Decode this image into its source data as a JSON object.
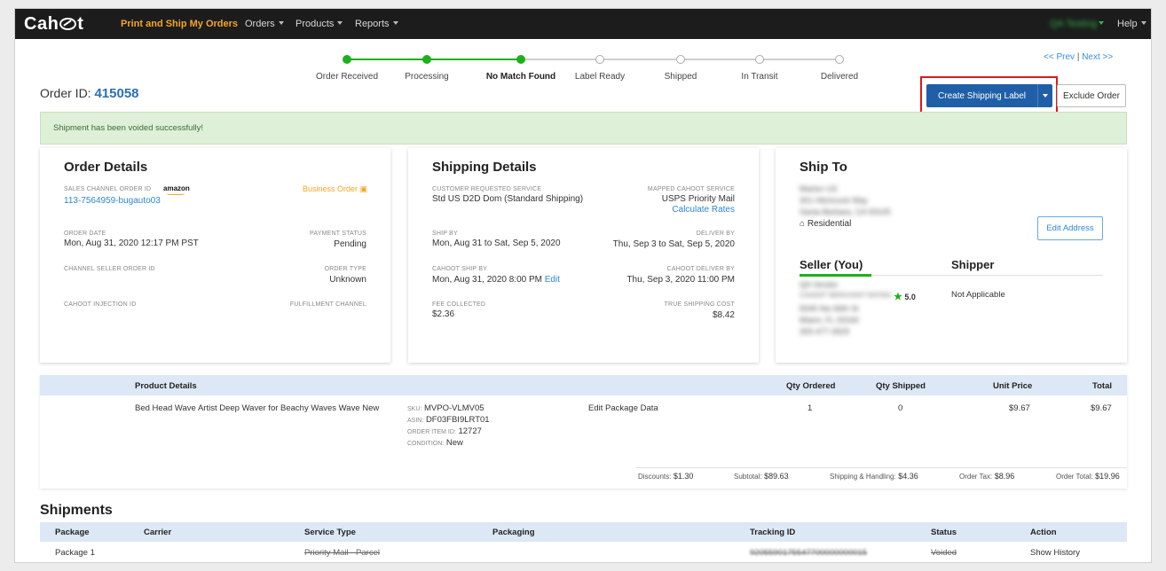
{
  "nav": {
    "logo": "Cah t",
    "active": "Print and Ship My Orders",
    "orders": "Orders",
    "products": "Products",
    "reports": "Reports",
    "user": "QA Testing",
    "help": "Help"
  },
  "progress": {
    "steps": [
      "Order Received",
      "Processing",
      "No Match Found",
      "Label Ready",
      "Shipped",
      "In Transit",
      "Delivered"
    ],
    "completed": 3
  },
  "pager": {
    "prev": "<< Prev",
    "sep": "|",
    "next": "Next >>"
  },
  "order": {
    "id_label": "Order ID:",
    "id": "415058"
  },
  "actions": {
    "create_label": "Create Shipping Label",
    "exclude": "Exclude Order"
  },
  "alert": "Shipment has been voided successfully!",
  "order_details": {
    "title": "Order Details",
    "sales_channel_label": "SALES CHANNEL ORDER ID",
    "amazon": "amazon",
    "business": "Business Order",
    "sales_channel_id": "113-7564959-bugauto03",
    "order_date_label": "ORDER DATE",
    "order_date": "Mon, Aug 31, 2020 12:17 PM PST",
    "payment_status_label": "PAYMENT STATUS",
    "payment_status": "Pending",
    "channel_seller_label": "CHANNEL SELLER ORDER ID",
    "order_type_label": "ORDER TYPE",
    "order_type": "Unknown",
    "injection_label": "CAHOOT INJECTION ID",
    "fulfillment_label": "FULFILLMENT CHANNEL"
  },
  "shipping_details": {
    "title": "Shipping Details",
    "customer_service_label": "CUSTOMER REQUESTED SERVICE",
    "customer_service": "Std US D2D Dom (Standard Shipping)",
    "mapped_label": "MAPPED CAHOOT SERVICE",
    "mapped": "USPS Priority Mail",
    "calc_rates": "Calculate Rates",
    "ship_by_label": "SHIP BY",
    "ship_by": "Mon, Aug 31 to Sat, Sep 5, 2020",
    "deliver_by_label": "DELIVER BY",
    "deliver_by": "Thu, Sep 3 to Sat, Sep 5, 2020",
    "cahoot_ship_label": "CAHOOT SHIP BY",
    "cahoot_ship": "Mon, Aug 31, 2020 8:00 PM",
    "edit": "Edit",
    "cahoot_deliver_label": "CAHOOT DELIVER BY",
    "cahoot_deliver": "Thu, Sep 3, 2020 11:00 PM",
    "fee_label": "FEE COLLECTED",
    "fee": "$2.36",
    "true_cost_label": "TRUE SHIPPING COST",
    "true_cost": "$8.42"
  },
  "ship_to": {
    "title": "Ship To",
    "name": "Marlon US",
    "street": "301 Hitchcock Way",
    "city": "Santa Barbara, CA 93105",
    "residential": "Residential",
    "edit_address": "Edit Address",
    "seller_title": "Seller (You)",
    "shipper_title": "Shipper",
    "seller_name": "QA Vendor",
    "rating_label": "CAHOOT MERCHANT RATING",
    "rating": "5.0",
    "seller_street": "8345 Nw 66th St",
    "seller_city": "Miami, FL 33166",
    "seller_phone": "305-477-3929",
    "shipper_value": "Not Applicable"
  },
  "products": {
    "headers": {
      "details": "Product Details",
      "qty_ordered": "Qty Ordered",
      "qty_shipped": "Qty Shipped",
      "unit_price": "Unit Price",
      "total": "Total"
    },
    "row": {
      "name": "Bed Head Wave Artist Deep Waver for Beachy Waves Wave New",
      "sku_label": "SKU:",
      "sku": "MVPO-VLMV05",
      "asin_label": "ASIN:",
      "asin": "DF03FBI9LRT01",
      "item_label": "ORDER ITEM ID:",
      "item": "12727",
      "cond_label": "CONDITION:",
      "cond": "New",
      "edit_pkg": "Edit Package Data",
      "qty_ordered": "1",
      "qty_shipped": "0",
      "unit_price": "$9.67",
      "total": "$9.67"
    },
    "totals": {
      "discounts_k": "Discounts:",
      "discounts": "$1.30",
      "subtotal_k": "Subtotal:",
      "subtotal": "$89.63",
      "sh_k": "Shipping & Handling:",
      "sh": "$4.36",
      "tax_k": "Order Tax:",
      "tax": "$8.96",
      "total_k": "Order Total:",
      "total": "$19.96"
    }
  },
  "shipments": {
    "title": "Shipments",
    "headers": {
      "package": "Package",
      "carrier": "Carrier",
      "service": "Service Type",
      "packaging": "Packaging",
      "tracking": "Tracking ID",
      "status": "Status",
      "action": "Action"
    },
    "row": {
      "package": "Package 1",
      "service": "Priority Mail - Parcel",
      "tracking": "9205590175547700000000015",
      "status": "Voided",
      "action": "Show History"
    }
  },
  "colors": {
    "accent": "#1f5fa8",
    "success": "#1db01d",
    "link": "#2f86d8",
    "highlight": "#e01818",
    "warning": "#f5a623"
  }
}
